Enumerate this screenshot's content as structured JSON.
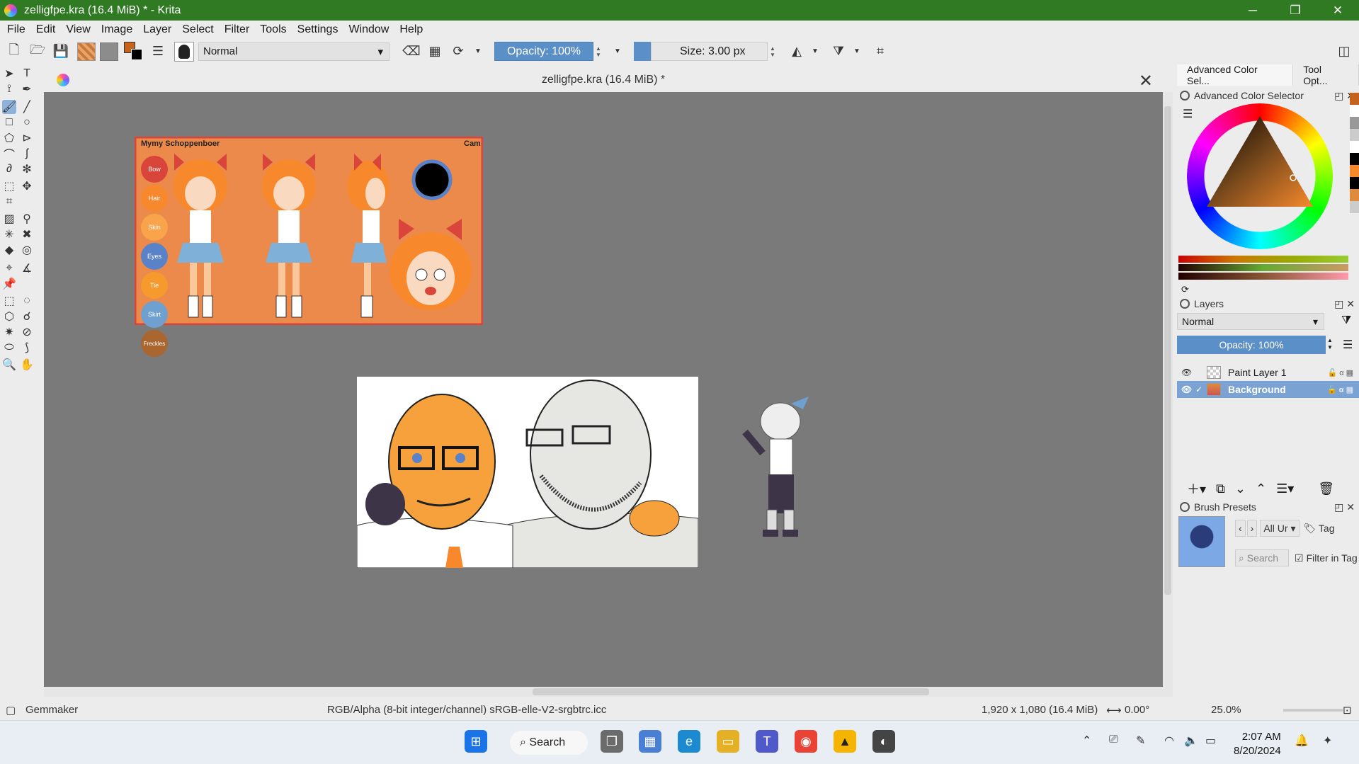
{
  "window": {
    "title": "zelligfpe.kra (16.4 MiB) * - Krita",
    "minimize": "─",
    "maximize": "❐",
    "close": "✕"
  },
  "menu": [
    "File",
    "Edit",
    "View",
    "Image",
    "Layer",
    "Select",
    "Filter",
    "Tools",
    "Settings",
    "Window",
    "Help"
  ],
  "toolbar": {
    "blend_mode": "Normal",
    "opacity": "Opacity: 100%",
    "size": "Size: 3.00 px"
  },
  "document": {
    "tab_title": "zelligfpe.kra (16.4 MiB) *"
  },
  "artwork": {
    "sheet_title": "Mymy Schoppenboer",
    "sheet_author": "Cam",
    "swatches": [
      {
        "label": "Bow",
        "color": "#d9453a"
      },
      {
        "label": "Hair",
        "color": "#f7892c"
      },
      {
        "label": "Skin",
        "color": "#f9a44a"
      },
      {
        "label": "Eyes",
        "color": "#5a82c8"
      },
      {
        "label": "Tie",
        "color": "#f79a2e"
      },
      {
        "label": "Skirt",
        "color": "#6fa0cf"
      },
      {
        "label": "Freckles",
        "color": "#a9662f"
      }
    ]
  },
  "right_panel": {
    "tabs": [
      "Advanced Color Sel...",
      "Tool Opt..."
    ],
    "color_selector_title": "Advanced Color Selector",
    "layers_title": "Layers",
    "layers_blend": "Normal",
    "layers_opacity": "Opacity:  100%",
    "layers": [
      {
        "name": "Paint Layer 1",
        "selected": false
      },
      {
        "name": "Background",
        "selected": true
      }
    ],
    "brush_presets_title": "Brush Presets",
    "brush_filter": "All Ur",
    "tag_label": "Tag",
    "search_placeholder": "Search",
    "filter_in_tag": "Filter in Tag"
  },
  "status": {
    "brush_name": "Gemmaker",
    "color_space": "RGB/Alpha (8-bit integer/channel)  sRGB-elle-V2-srgbtrc.icc",
    "dimensions": "1,920 x 1,080 (16.4 MiB)",
    "rotation": "0.00°",
    "zoom": "25.0%"
  },
  "taskbar": {
    "search_label": "Search",
    "time": "2:07 AM",
    "date": "8/20/2024"
  },
  "colors": {
    "titlebar": "#2f7a23",
    "accent": "#5a8fc7",
    "canvas_bg": "#7a7a7a"
  }
}
